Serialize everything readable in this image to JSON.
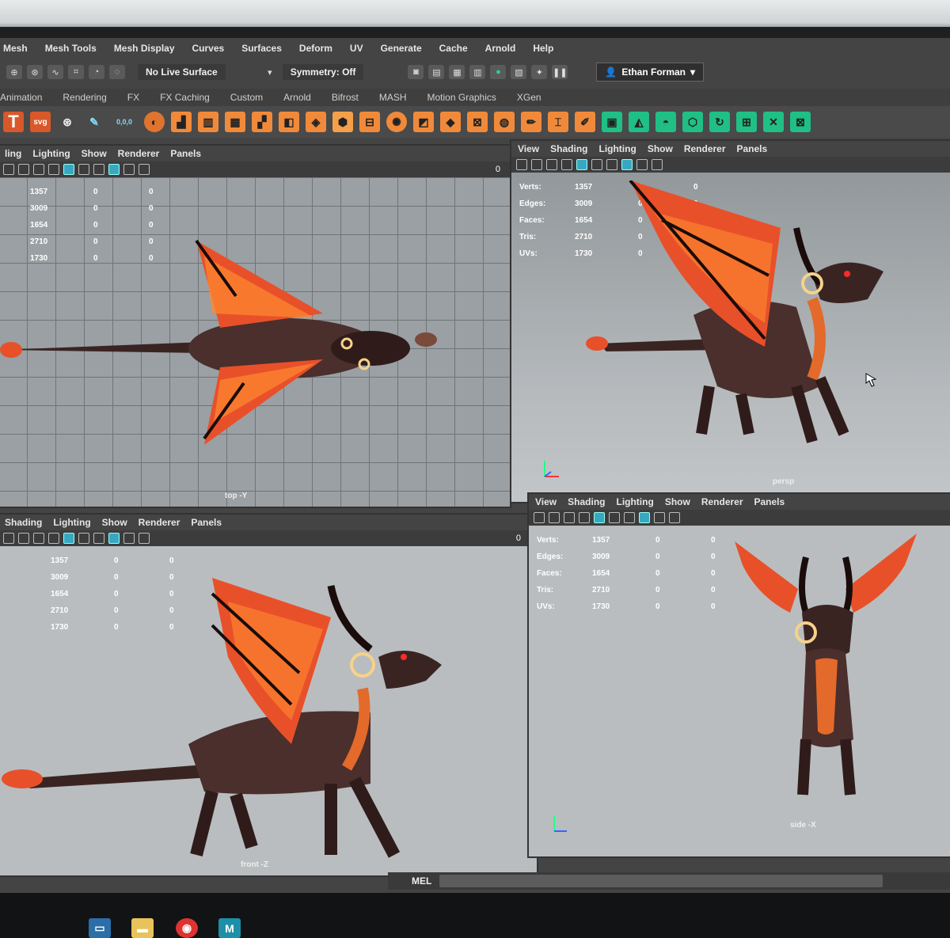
{
  "menubar": [
    "Mesh",
    "Mesh Tools",
    "Mesh Display",
    "Curves",
    "Surfaces",
    "Deform",
    "UV",
    "Generate",
    "Cache",
    "Arnold",
    "Help"
  ],
  "status": {
    "live_surface": "No Live Surface",
    "symmetry": "Symmetry: Off",
    "user": "Ethan Forman"
  },
  "shelf_tabs": [
    "Animation",
    "Rendering",
    "FX",
    "FX Caching",
    "Custom",
    "Arnold",
    "Bifrost",
    "MASH",
    "Motion Graphics",
    "XGen"
  ],
  "shelf_svg_label": "svg",
  "shelf_coord_label": "0,0,0",
  "panel_menu": [
    "View",
    "Shading",
    "Lighting",
    "Show",
    "Renderer",
    "Panels"
  ],
  "panel_menu_cut": [
    "ling",
    "Lighting",
    "Show",
    "Renderer",
    "Panels"
  ],
  "panel_menu_cut2": [
    "Shading",
    "Lighting",
    "Show",
    "Renderer",
    "Panels"
  ],
  "hud_labels": [
    "Verts:",
    "Edges:",
    "Faces:",
    "Tris:",
    "UVs:"
  ],
  "hud_values": [
    "1357",
    "3009",
    "1654",
    "2710",
    "1730"
  ],
  "hud_zero": "0",
  "toolbar_end_value": "0",
  "camera_labels": {
    "top": "top -Y",
    "persp": "persp",
    "front": "front -Z",
    "side": "side -X"
  },
  "cmd": {
    "label": "MEL"
  },
  "colors": {
    "maya_bg": "#444444",
    "accent_cyan": "#38a8c2",
    "dragon_body": "#4a2f2c",
    "dragon_wing": "#e8502a",
    "dragon_glow": "#ff8a30",
    "shelf_green": "#1fbf86"
  }
}
